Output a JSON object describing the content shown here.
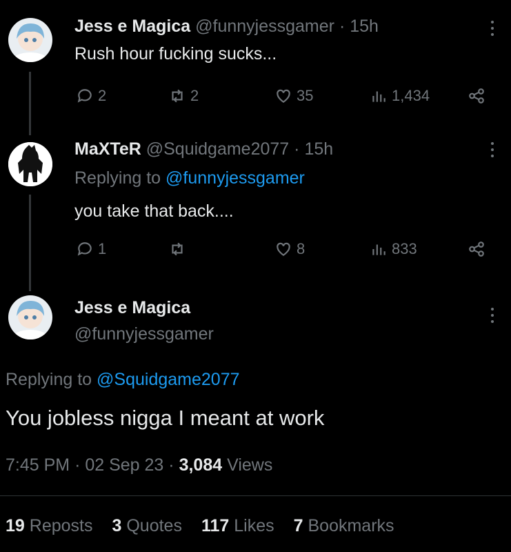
{
  "tweet1": {
    "name": "Jess e Magica",
    "handle": "@funnyjessgamer",
    "sep": "·",
    "time": "15h",
    "text": "Rush hour fucking sucks...",
    "replies": "2",
    "reposts": "2",
    "likes": "35",
    "views": "1,434"
  },
  "tweet2": {
    "name": "MaXTeR",
    "handle": "@Squidgame2077",
    "sep": "·",
    "time": "15h",
    "replying_prefix": "Replying to",
    "replying_handle": "@funnyjessgamer",
    "text": "you take that back....",
    "replies": "1",
    "reposts": "",
    "likes": "8",
    "views": "833"
  },
  "main": {
    "name": "Jess e Magica",
    "handle": "@funnyjessgamer",
    "replying_prefix": "Replying to",
    "replying_handle": "@Squidgame2077",
    "text": "You jobless nigga I meant at work",
    "time": "7:45 PM",
    "sep1": "·",
    "date": "02 Sep 23",
    "sep2": "·",
    "views_count": "3,084",
    "views_label": "Views"
  },
  "stats": {
    "reposts_count": "19",
    "reposts_label": "Reposts",
    "quotes_count": "3",
    "quotes_label": "Quotes",
    "likes_count": "117",
    "likes_label": "Likes",
    "bookmarks_count": "7",
    "bookmarks_label": "Bookmarks"
  },
  "colors": {
    "background": "#000000",
    "text": "#e7e9ea",
    "muted": "#71767b",
    "link": "#1d9bf0"
  }
}
